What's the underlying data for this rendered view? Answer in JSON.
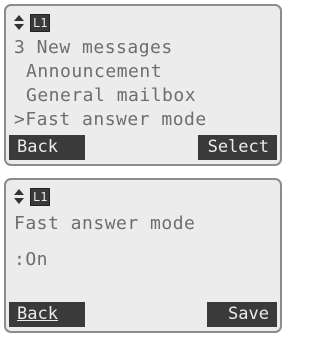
{
  "screen1": {
    "line_badge": "L1",
    "menu_title": "3 New messages",
    "items": [
      {
        "label": "Announcement",
        "selected": false
      },
      {
        "label": "General mailbox",
        "selected": false
      },
      {
        "label": ">Fast answer mode",
        "selected": true
      }
    ],
    "softkeys": {
      "left": "Back",
      "right": "Select"
    }
  },
  "screen2": {
    "line_badge": "L1",
    "title": "Fast answer mode",
    "value": ":On",
    "softkeys": {
      "left": "Back",
      "right": "Save"
    }
  },
  "colors": {
    "screen_bg": "#ececec",
    "text": "#6e6e6e",
    "softkey_bg": "#3a3a3a",
    "softkey_text": "#ececec"
  },
  "icons": {
    "navigation": "updown-arrows-icon"
  }
}
